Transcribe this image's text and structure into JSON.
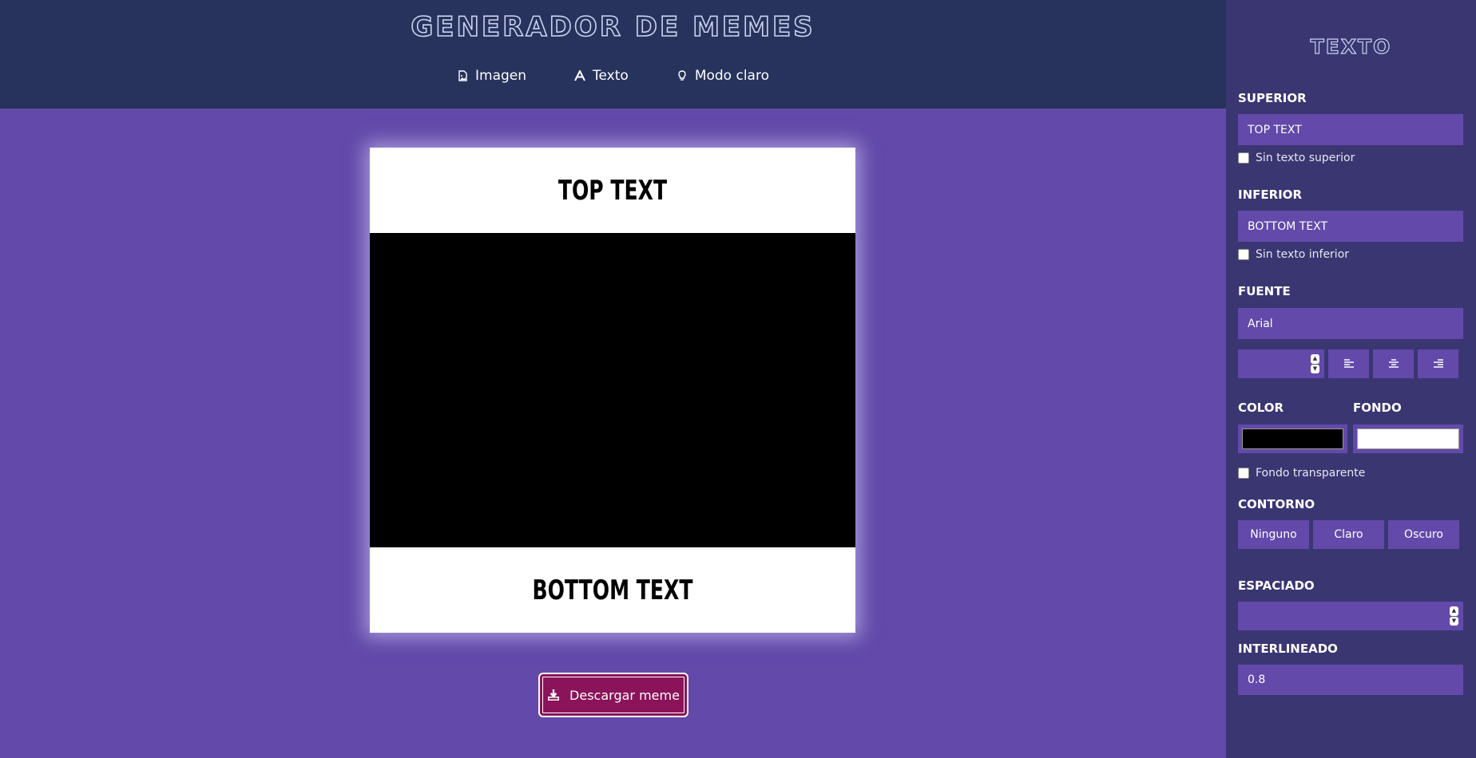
{
  "header": {
    "title": "GENERADOR DE MEMES",
    "nav": [
      {
        "label": "Imagen",
        "icon": "image-file-icon"
      },
      {
        "label": "Texto",
        "icon": "text-icon"
      },
      {
        "label": "Modo claro",
        "icon": "lightbulb-icon"
      }
    ]
  },
  "meme": {
    "top_text": "TOP TEXT",
    "bottom_text": "BOTTOM TEXT"
  },
  "download": {
    "label": "Descargar meme",
    "icon": "download-icon"
  },
  "sidebar": {
    "title": "TEXTO",
    "superior_label": "SUPERIOR",
    "superior_value": "TOP TEXT",
    "no_superior_label": "Sin texto superior",
    "inferior_label": "INFERIOR",
    "inferior_value": "BOTTOM TEXT",
    "no_inferior_label": "Sin texto inferior",
    "fuente_label": "FUENTE",
    "fuente_value": "Arial",
    "color_label": "COLOR",
    "fondo_label": "FONDO",
    "text_color": "#000000",
    "bg_color": "#ffffff",
    "transparent_label": "Fondo transparente",
    "contorno_label": "CONTORNO",
    "contorno_options": [
      "Ninguno",
      "Claro",
      "Oscuro"
    ],
    "espaciado_label": "ESPACIADO",
    "interlineado_label": "INTERLINEADO",
    "interlineado_value": "0.8"
  },
  "colors": {
    "page_bg": "#6249aa",
    "header_bg": "#27335c",
    "sidebar_bg": "#3a3672",
    "download_bg": "#8b1359"
  }
}
